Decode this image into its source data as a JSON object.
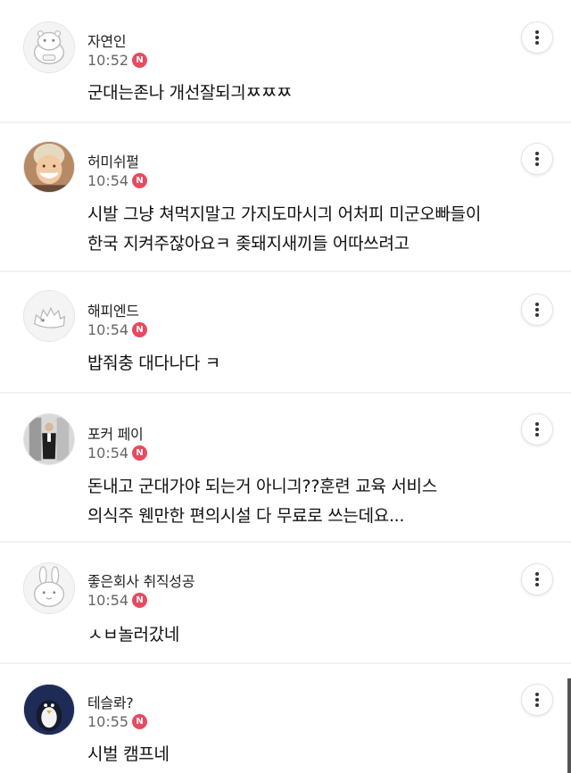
{
  "comments": [
    {
      "nickname": "자연인",
      "time": "10:52",
      "badge": "N",
      "text": "군대는존나 개선잘되긔ㅉㅉㅉ",
      "avatar": "default-hippo-icon"
    },
    {
      "nickname": "허미쉬펄",
      "time": "10:54",
      "badge": "N",
      "text": "시발 그냥 쳐먹지말고 가지도마시긔 어처피 미군오빠들이\n한국 지켜주잖아요ㅋ 좆돼지새끼들 어따쓰려고",
      "avatar": "profile-photo-smiling-woman"
    },
    {
      "nickname": "해피엔드",
      "time": "10:54",
      "badge": "N",
      "text": "밥줘충 대다나다 ㅋ",
      "avatar": "default-hedgehog-icon"
    },
    {
      "nickname": "포커 페이",
      "time": "10:54",
      "badge": "N",
      "text": "돈내고 군대가야 되는거 아니긔??훈련 교육 서비스\n의식주 웬만한 편의시설 다 무료로 쓰는데요...",
      "avatar": "profile-photo-man-in-suit"
    },
    {
      "nickname": "좋은회사 취직성공",
      "time": "10:54",
      "badge": "N",
      "text": "ㅅㅂ놀러갔네",
      "avatar": "default-rabbit-icon"
    },
    {
      "nickname": "테슬롸?",
      "time": "10:55",
      "badge": "N",
      "text": "시벌 캠프네",
      "avatar": "profile-photo-penguin"
    }
  ],
  "colors": {
    "badge": "#e84a5f",
    "separator": "#f2f2f2"
  },
  "more_icon": "vertical-ellipsis-icon"
}
